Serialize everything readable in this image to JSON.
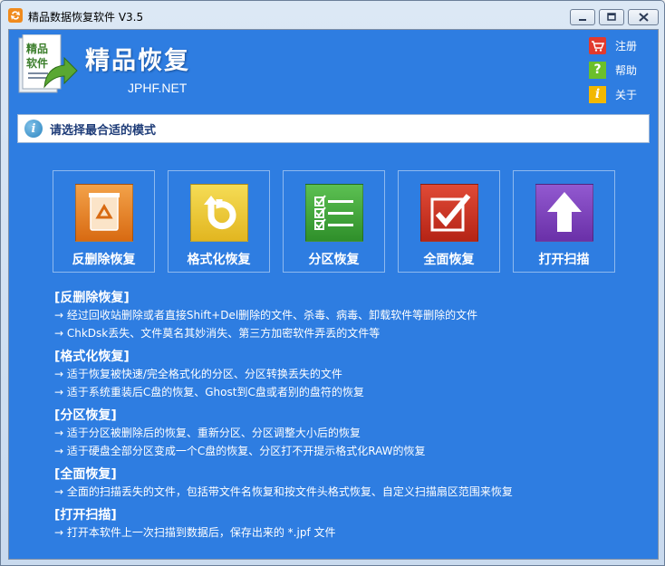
{
  "window": {
    "title": "精品数据恢复软件 V3.5"
  },
  "header": {
    "brand_title": "精品恢复",
    "brand_url": "JPHF.NET",
    "logo_text": "精品软件",
    "links": [
      {
        "label": "注册",
        "icon": "cart-icon",
        "color": "#e23a2e"
      },
      {
        "label": "帮助",
        "icon": "question-icon",
        "color": "#6bbf2a"
      },
      {
        "label": "关于",
        "icon": "info-icon",
        "color": "#f2b800"
      }
    ]
  },
  "mode_bar": {
    "text": "请选择最合适的模式"
  },
  "tiles": [
    {
      "label": "反删除恢复",
      "icon": "recycle-bin-icon",
      "color": "#e8781f"
    },
    {
      "label": "格式化恢复",
      "icon": "refresh-icon",
      "color": "#e8c52a"
    },
    {
      "label": "分区恢复",
      "icon": "checklist-icon",
      "color": "#43a53a"
    },
    {
      "label": "全面恢复",
      "icon": "checkmark-icon",
      "color": "#c83223"
    },
    {
      "label": "打开扫描",
      "icon": "upload-arrow-icon",
      "color": "#7a40b8"
    }
  ],
  "descriptions": {
    "undelete": {
      "heading": "[反删除恢复]",
      "lines": [
        "→ 经过回收站删除或者直接Shift+Del删除的文件、杀毒、病毒、卸载软件等删除的文件",
        "→ ChkDsk丢失、文件莫名其妙消失、第三方加密软件弄丢的文件等"
      ]
    },
    "format": {
      "heading": "[格式化恢复]",
      "lines": [
        "→ 适于恢复被快速/完全格式化的分区、分区转换丢失的文件",
        "→ 适于系统重装后C盘的恢复、Ghost到C盘或者别的盘符的恢复"
      ]
    },
    "partition": {
      "heading": "[分区恢复]",
      "lines": [
        "→ 适于分区被删除后的恢复、重新分区、分区调整大小后的恢复",
        "→ 适于硬盘全部分区变成一个C盘的恢复、分区打不开提示格式化RAW的恢复"
      ]
    },
    "full": {
      "heading": "[全面恢复]",
      "lines": [
        "→ 全面的扫描丢失的文件，包括带文件名恢复和按文件头格式恢复、自定义扫描扇区范围来恢复"
      ]
    },
    "open_scan": {
      "heading": "[打开扫描]",
      "lines": [
        "→ 打开本软件上一次扫描到数据后，保存出来的 *.jpf 文件"
      ]
    }
  }
}
